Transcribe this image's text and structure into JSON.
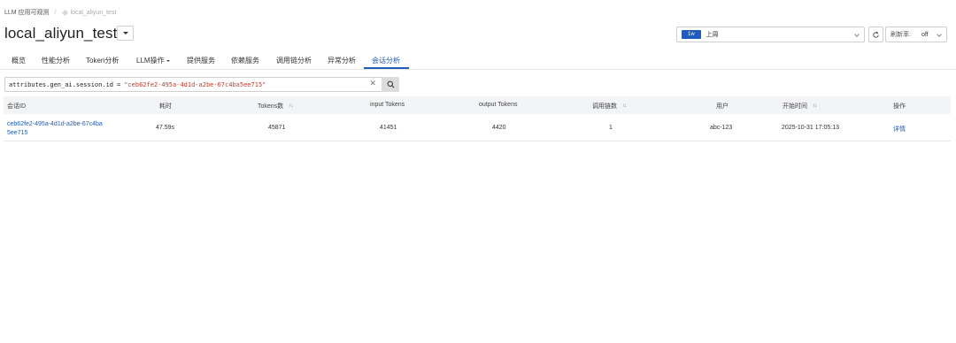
{
  "breadcrumb": {
    "root": "LLM 应用可观测",
    "current": "local_aliyun_test"
  },
  "title": "local_aliyun_test",
  "time_range": {
    "badge": "1w",
    "label": "上周"
  },
  "refresh": {
    "label": "刷新率:",
    "value": "off"
  },
  "tabs": [
    {
      "label": "概览"
    },
    {
      "label": "性能分析"
    },
    {
      "label": "Token分析"
    },
    {
      "label": "LLM操作"
    },
    {
      "label": "提供服务"
    },
    {
      "label": "依赖服务"
    },
    {
      "label": "调用链分析"
    },
    {
      "label": "异常分析"
    },
    {
      "label": "会话分析",
      "active": true
    }
  ],
  "query": {
    "key": "attributes.gen_ai.session.id",
    "op": "=",
    "value": "\"ceb62fe2-495a-4d1d-a2be-67c4ba5ee715\""
  },
  "table": {
    "columns": [
      "会话ID",
      "耗时",
      "Tokens数",
      "input Tokens",
      "output Tokens",
      "调用链数",
      "用户",
      "开始时间",
      "操作"
    ],
    "rows": [
      {
        "session_id": "ceb62fe2-495a-4d1d-a2be-67c4ba5ee715",
        "duration": "47.59s",
        "tokens": "45871",
        "input_tokens": "41451",
        "output_tokens": "4420",
        "traces": "1",
        "user": "abc-123",
        "start_time": "2025-10-31 17:05:13",
        "action": "详情"
      }
    ]
  },
  "colors": {
    "accent": "#1e5bbd",
    "query_value": "#c0392b",
    "header_bg": "#f3f4f6"
  }
}
